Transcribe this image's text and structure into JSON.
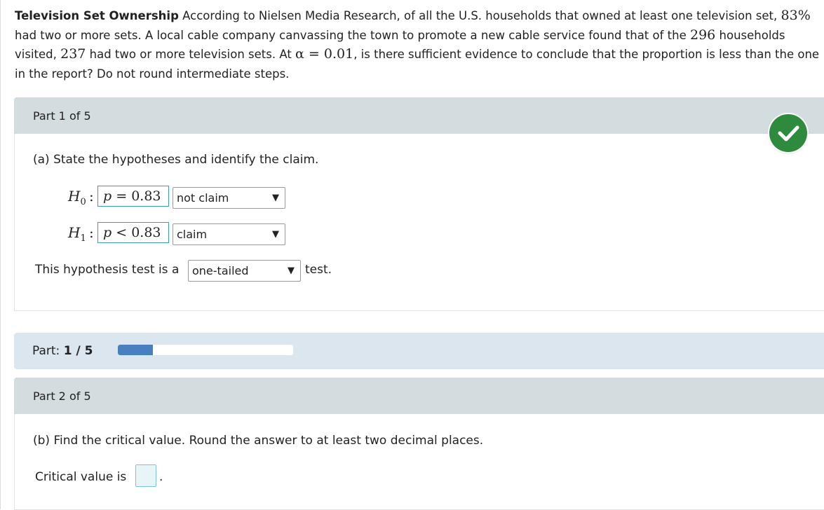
{
  "problem": {
    "title": "Television Set Ownership",
    "seg1": "According to Nielsen Media Research, of all the U.S. households that owned at least one television set,",
    "pct": "83%",
    "seg2": "had two or more sets. A local cable company canvassing the town to promote a new cable service found that of the",
    "n": "296",
    "seg3": "households visited,",
    "x": "237",
    "seg4": "had two or more television sets. At",
    "alpha": "α = 0.01",
    "seg5": ", is there sufficient evidence to conclude that the proportion is less than the one in the report? Do not round intermediate steps."
  },
  "part1": {
    "header": "Part 1 of 5",
    "status": "correct",
    "question": "(a) State the hypotheses and identify the claim.",
    "h0": {
      "label": "H",
      "sub": "0",
      "colon": ":",
      "var": "p",
      "rel": "=",
      "val": "0.83",
      "select_value": "not claim"
    },
    "h1": {
      "label": "H",
      "sub": "1",
      "colon": ":",
      "var": "p",
      "rel": "<",
      "val": "0.83",
      "select_value": "claim"
    },
    "test_prefix": "This hypothesis test is a",
    "test_type": "one-tailed",
    "test_suffix": "test."
  },
  "progress": {
    "label": "Part:",
    "value": "1 / 5",
    "fraction": 0.2,
    "fill_color": "#4a7fbf"
  },
  "part2": {
    "header": "Part 2 of 5",
    "question": "(b) Find the critical value. Round the answer to at least two decimal places.",
    "answer_label": "Critical value is",
    "answer_value": "",
    "period": "."
  },
  "icons": {
    "dropdown": "▼",
    "correct": "checkmark-icon"
  },
  "colors": {
    "header_bg": "#d3dcdf",
    "progress_bg": "#dce6ee",
    "correct_green": "#2e8b3e",
    "input_border": "#3b9eae"
  }
}
